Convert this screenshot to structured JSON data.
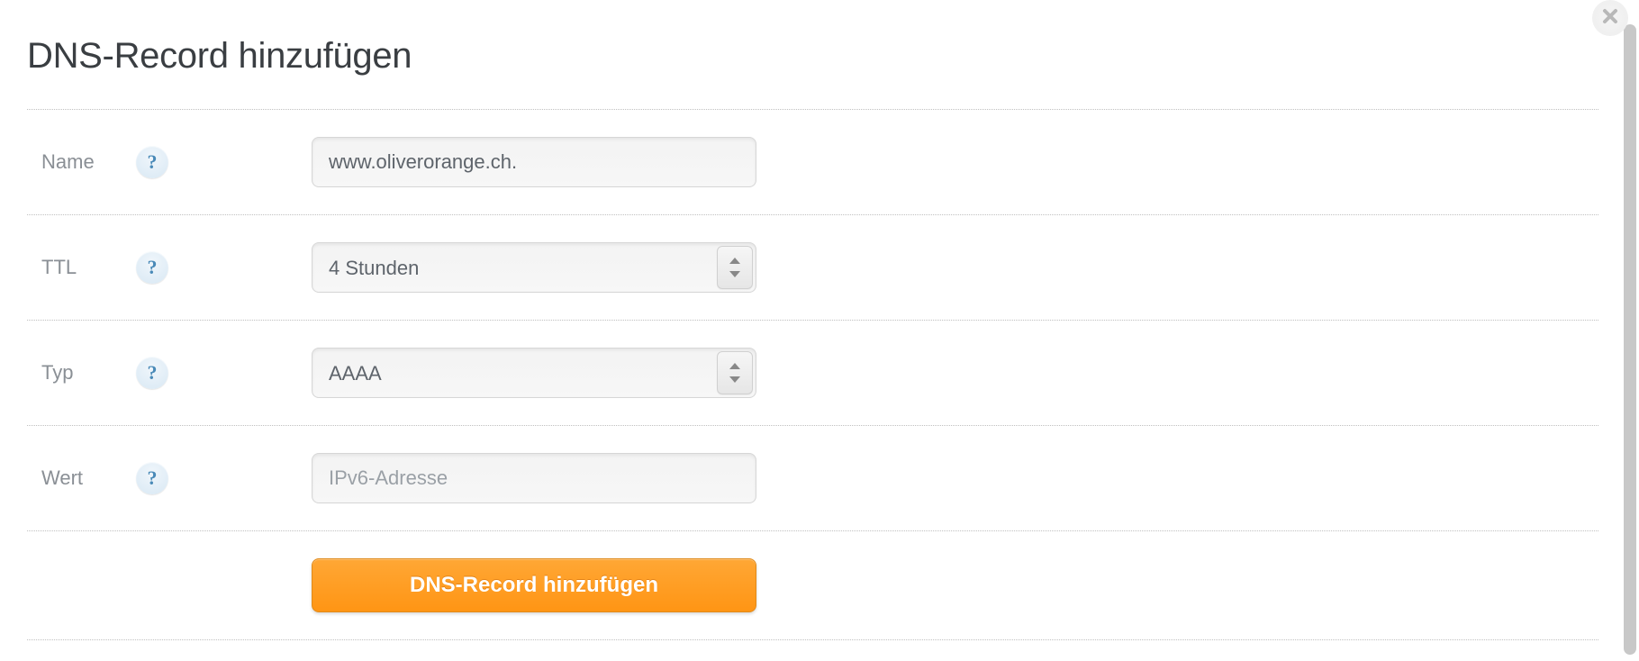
{
  "title": "DNS-Record hinzufügen",
  "fields": {
    "name": {
      "label": "Name",
      "value": "www.oliverorange.ch."
    },
    "ttl": {
      "label": "TTL",
      "value": "4 Stunden"
    },
    "type": {
      "label": "Typ",
      "value": "AAAA"
    },
    "wert": {
      "label": "Wert",
      "placeholder": "IPv6-Adresse"
    }
  },
  "submit_label": "DNS-Record hinzufügen",
  "help_glyph": "?"
}
